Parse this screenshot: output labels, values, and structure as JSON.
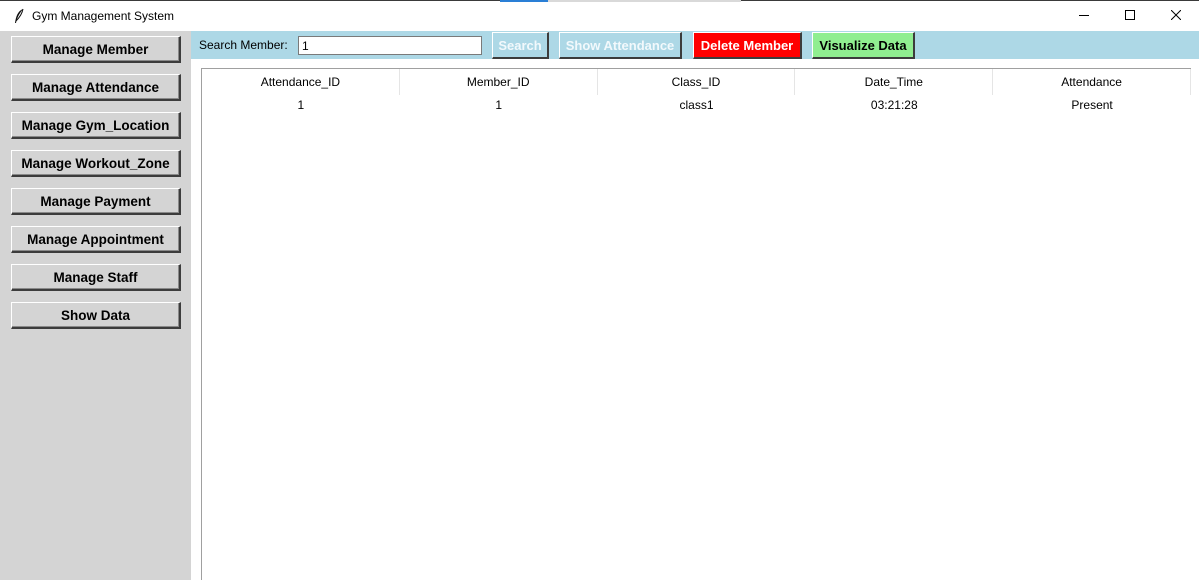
{
  "window": {
    "title": "Gym Management System",
    "icon": "feather-icon",
    "controls": [
      "minimize-icon",
      "maximize-icon",
      "close-icon"
    ]
  },
  "sidebar": {
    "items": [
      {
        "label": "Manage Member"
      },
      {
        "label": "Manage Attendance"
      },
      {
        "label": "Manage Gym_Location"
      },
      {
        "label": "Manage Workout_Zone"
      },
      {
        "label": "Manage Payment"
      },
      {
        "label": "Manage Appointment"
      },
      {
        "label": "Manage Staff"
      },
      {
        "label": "Show Data"
      }
    ]
  },
  "toolbar": {
    "search_label": "Search Member:",
    "search_value": "1",
    "search_button": "Search",
    "show_attendance_button": "Show Attendance",
    "delete_button": "Delete Member",
    "visualize_button": "Visualize Data",
    "colors": {
      "background": "#add8e6",
      "delete": "#ff0000",
      "visualize": "#90ee90"
    }
  },
  "table": {
    "columns": [
      "Attendance_ID",
      "Member_ID",
      "Class_ID",
      "Date_Time",
      "Attendance"
    ],
    "rows": [
      [
        "1",
        "1",
        "class1",
        "03:21:28",
        "Present"
      ]
    ]
  }
}
